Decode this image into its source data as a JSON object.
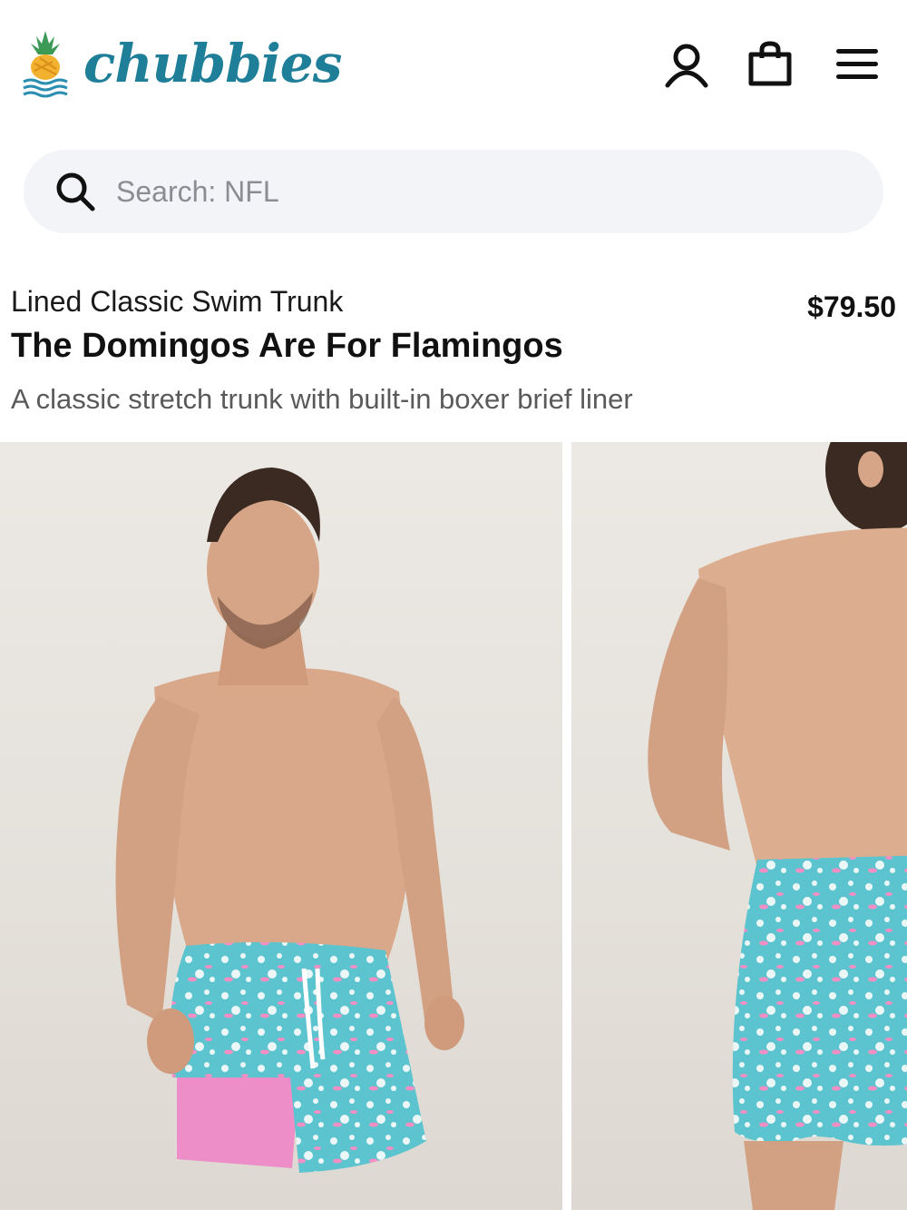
{
  "header": {
    "brand_name": "chubbies",
    "icons": [
      "account-icon",
      "shopping-bag-icon",
      "menu-icon"
    ]
  },
  "search": {
    "placeholder": "Search: NFL"
  },
  "product": {
    "subtitle": "Lined Classic Swim Trunk",
    "title": "The Domingos Are For Flamingos",
    "description": "A classic stretch trunk with built-in boxer brief liner",
    "price": "$79.50"
  },
  "gallery": {
    "images": [
      "front-view-photo",
      "back-view-photo"
    ]
  },
  "colors": {
    "brand": "#1f7f98",
    "search_bg": "#f3f4f7",
    "trunk_teal": "#5cc4cf",
    "liner_pink": "#ee8ec8"
  }
}
